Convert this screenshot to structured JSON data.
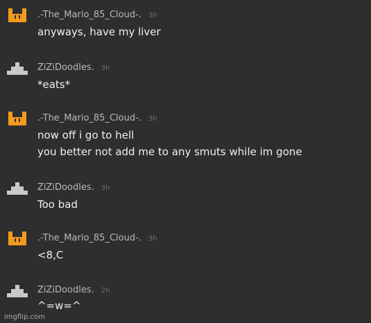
{
  "messages": [
    {
      "user": ".-The_Mario_85_Cloud-.",
      "time": "3h",
      "avatar": "orange-castle-icon",
      "lines": [
        "anyways, have my liver"
      ]
    },
    {
      "user": "ZiZiDoodles.",
      "time": "3h",
      "avatar": "gray-pyramid-icon",
      "lines": [
        "*eats*"
      ]
    },
    {
      "user": ".-The_Mario_85_Cloud-.",
      "time": "3h",
      "avatar": "orange-castle-icon",
      "lines": [
        "now off i go to hell",
        "you better not add me to any smuts while im gone"
      ]
    },
    {
      "user": "ZiZiDoodles.",
      "time": "3h",
      "avatar": "gray-pyramid-icon",
      "lines": [
        "Too bad"
      ]
    },
    {
      "user": ".-The_Mario_85_Cloud-.",
      "time": "3h",
      "avatar": "orange-castle-icon",
      "lines": [
        "<8,C"
      ]
    },
    {
      "user": "ZiZiDoodles.",
      "time": "2h",
      "avatar": "gray-pyramid-icon",
      "lines": [
        "^=w=^"
      ]
    }
  ],
  "watermark": "imgflip.com",
  "colors": {
    "background": "#2e2e2e",
    "orange_avatar": "#f39a1c",
    "gray_avatar": "#c9c9c9"
  }
}
